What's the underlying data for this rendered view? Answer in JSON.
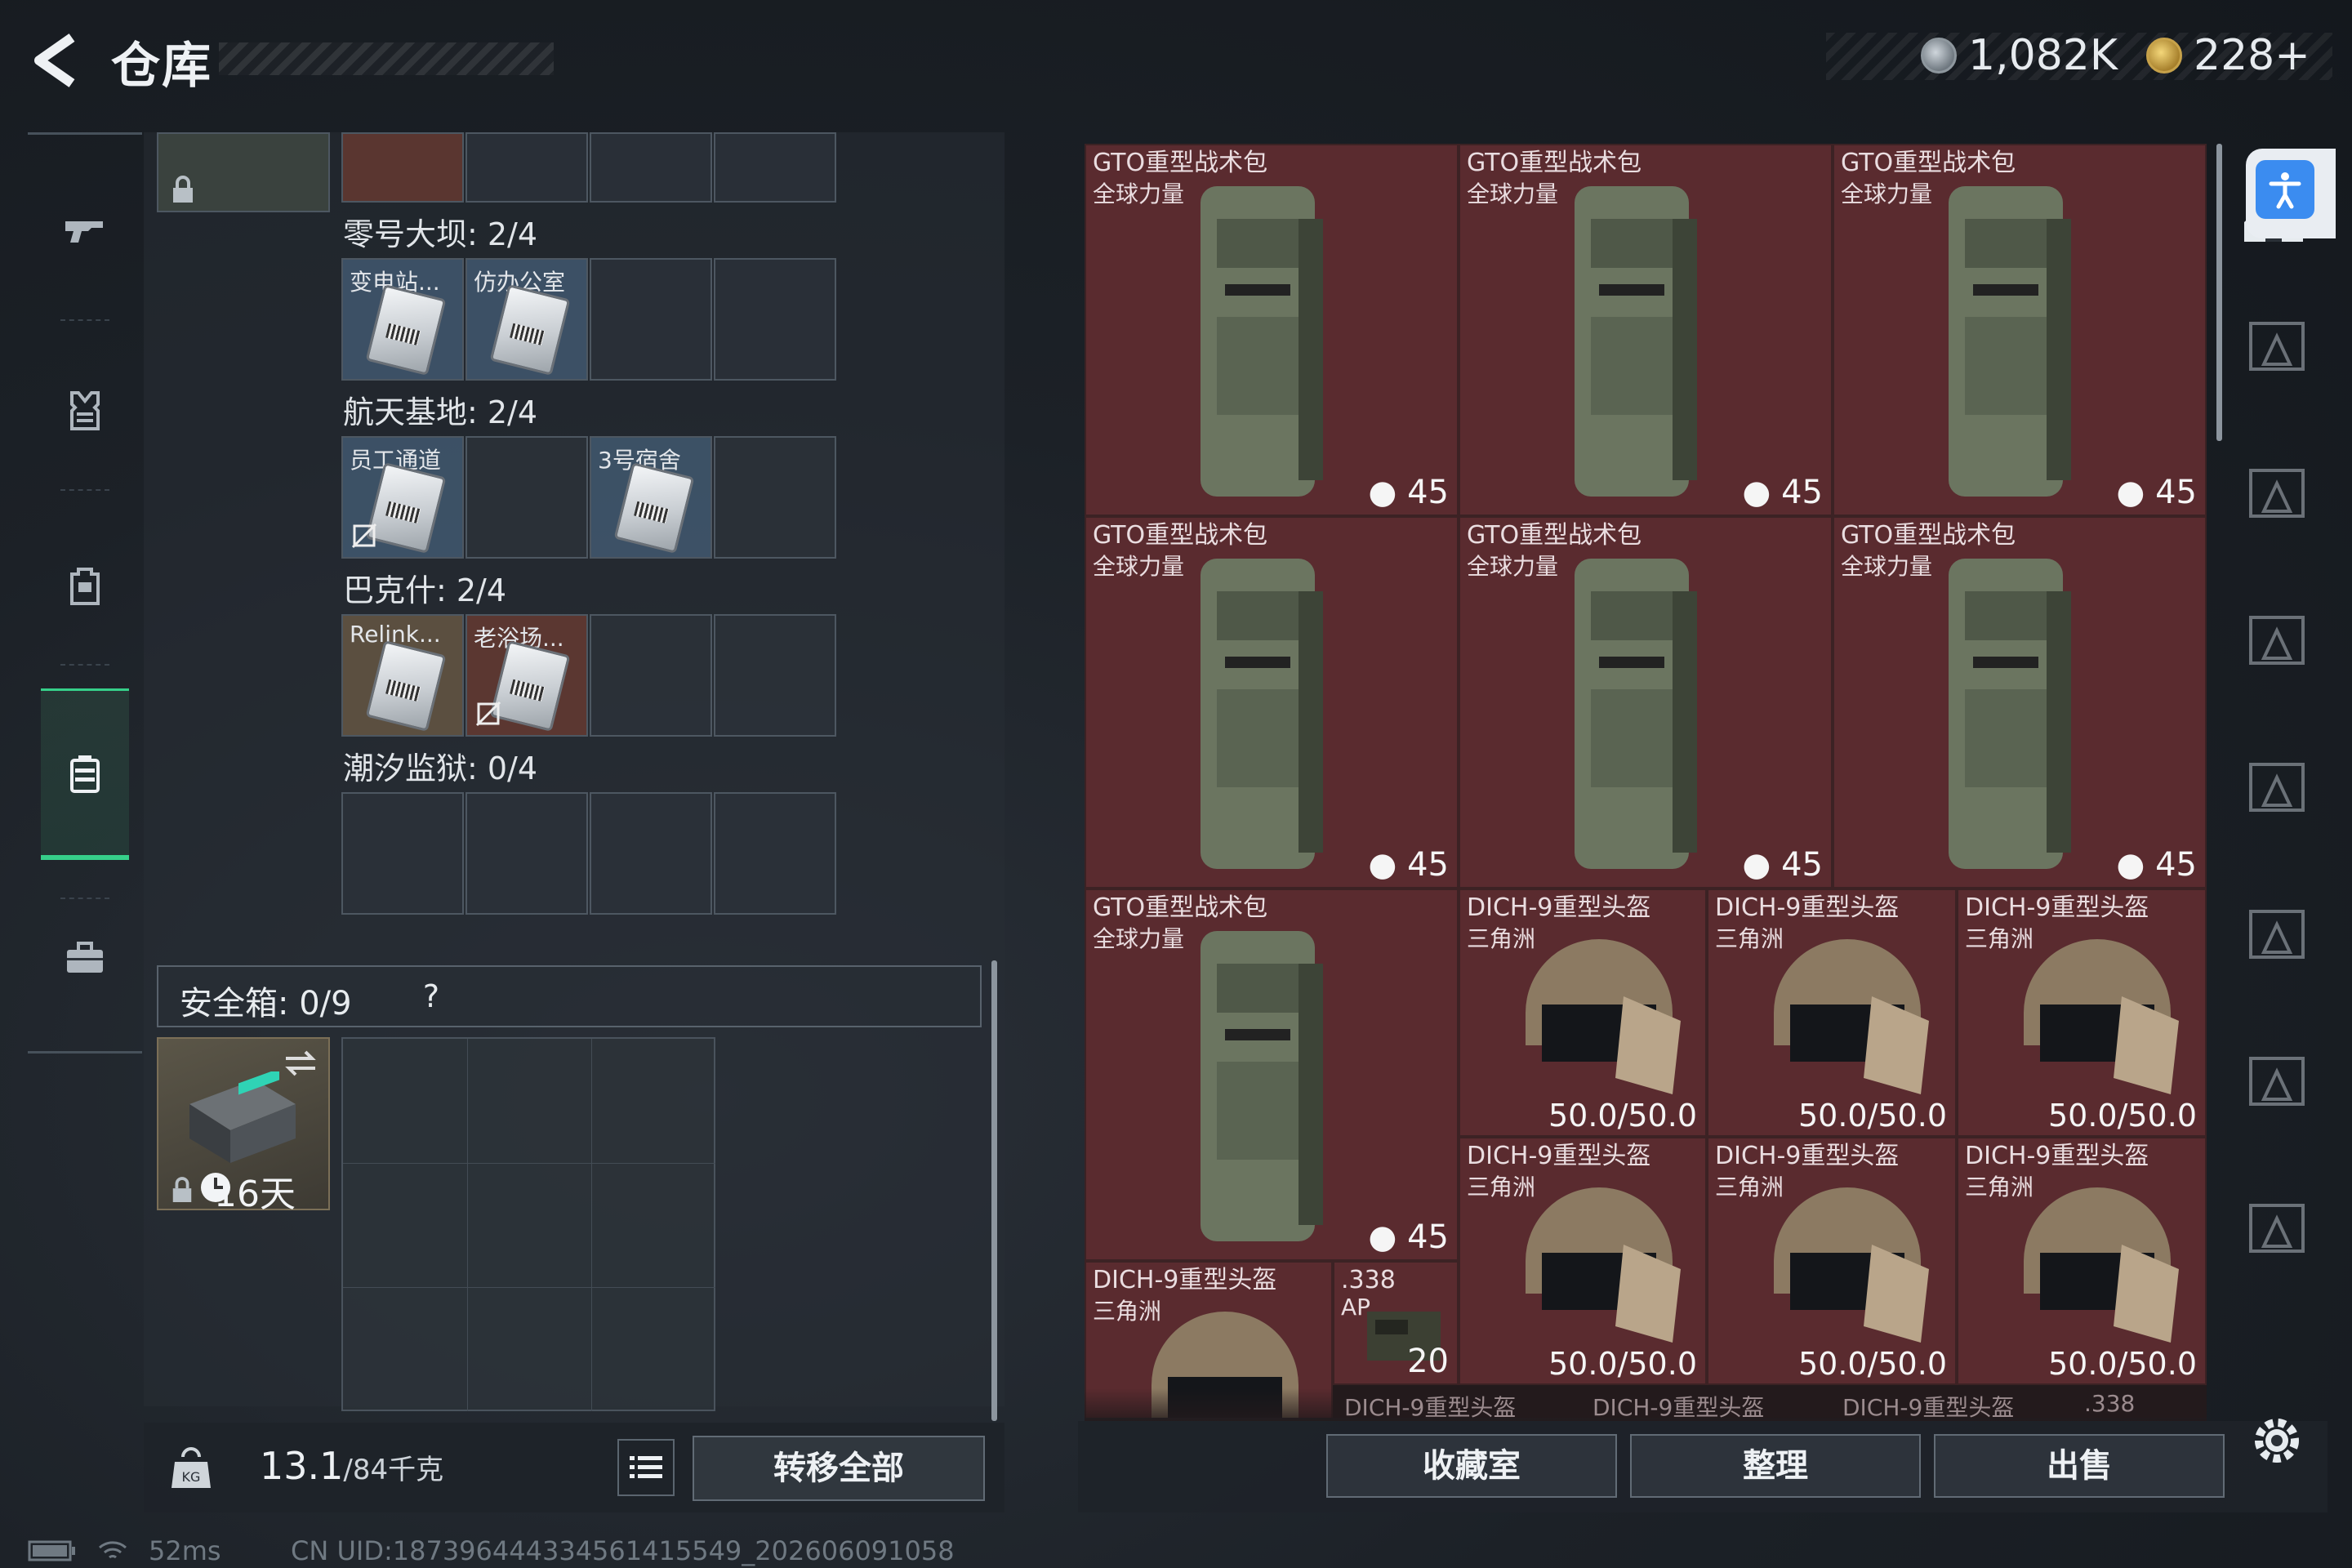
{
  "header": {
    "title": "仓库",
    "currency": [
      {
        "icon": "silver-coin-icon",
        "value": "1,082K"
      },
      {
        "icon": "gold-coin-icon",
        "value": "228+"
      }
    ]
  },
  "rail": [
    "gun-icon",
    "armor-vest-icon",
    "backpack-icon",
    "container-icon",
    "briefcase-icon"
  ],
  "stash": {
    "groups": [
      {
        "title": "零号大坝: 2/4",
        "cards": [
          {
            "label": "变电站..."
          },
          {
            "label": "仿办公室"
          }
        ]
      },
      {
        "title": "航天基地: 2/4",
        "cards": [
          {
            "label": "员工通道"
          },
          {
            "label": "3号宿舍"
          }
        ]
      },
      {
        "title": "巴克什: 2/4",
        "cards": [
          {
            "label": "Relink..."
          },
          {
            "label": "老浴场..."
          }
        ]
      },
      {
        "title": "潮汐监狱: 0/4",
        "cards": []
      }
    ],
    "secure_box": {
      "label": "安全箱: 0/9",
      "help": "?",
      "timer": "16天"
    },
    "weight": {
      "value": "13.1",
      "unit": "/84千克"
    },
    "transfer_all": "转移全部"
  },
  "inventory": {
    "backpack_name": "GTO重型战术包",
    "backpack_sub": "全球力量",
    "backpack_count": "45",
    "helmet_name": "DICH-9重型头盔",
    "helmet_sub": "三角洲",
    "helmet_durability": "50.0/50.0",
    "ammo_name": ".338",
    "ammo_sub": "AP",
    "ammo_count": "20",
    "cutoff_labels": [
      "DICH-9重型头盔",
      "DICH-9重型头盔",
      "DICH-9重型头盔",
      ".338"
    ]
  },
  "bottom_buttons": {
    "collection": "收藏室",
    "sort": "整理",
    "sell": "出售"
  },
  "status": {
    "ping": "52ms",
    "uid": "CN UID:1873964443345614155​49_202606091058"
  },
  "colors": {
    "accent_green": "#36d08a",
    "item_red": "#5a2b2f",
    "access_blue": "#3b8cf0"
  }
}
